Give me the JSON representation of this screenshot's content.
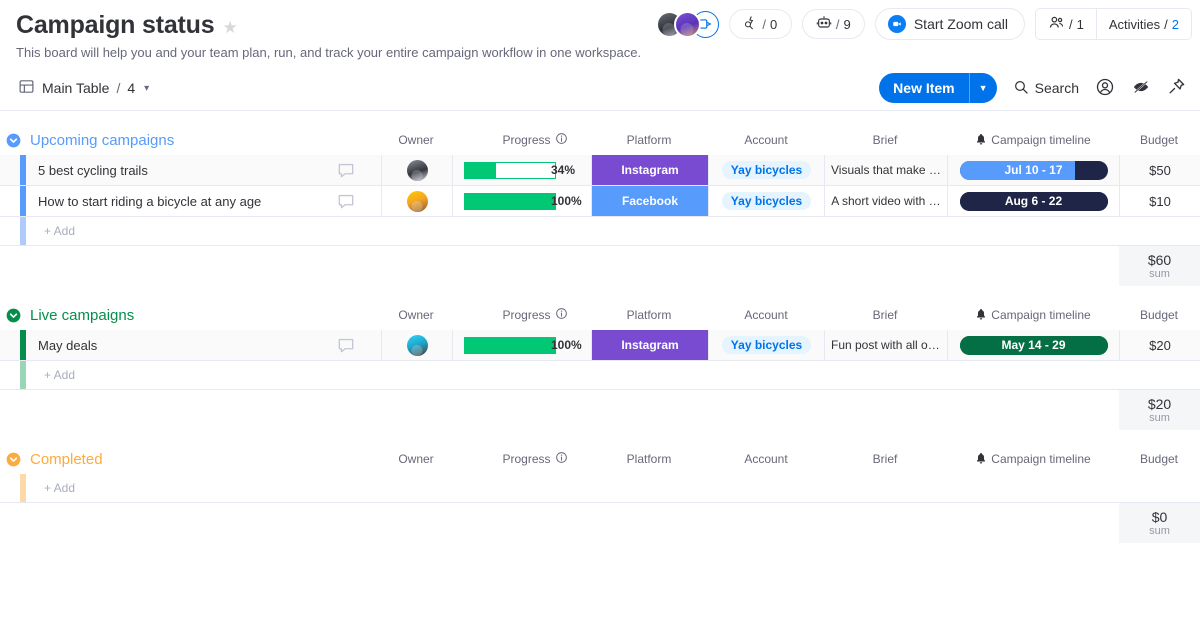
{
  "header": {
    "title": "Campaign status",
    "star_icon": "star-icon",
    "subtitle": "This board will help you and your team plan, run, and track your entire campaign workflow in one workspace.",
    "integrations": {
      "icon": "integrations-icon",
      "slash": "/",
      "count": "0"
    },
    "automations": {
      "icon": "automation-robot-icon",
      "slash": "/",
      "count": "9"
    },
    "zoom_call": {
      "icon": "zoom-camera-icon",
      "label": "Start Zoom call"
    },
    "members": {
      "icon": "people-icon",
      "slash": "/",
      "count": "1"
    },
    "activities": {
      "label": "Activities",
      "slash": "/",
      "count": "2"
    }
  },
  "toolbar": {
    "table_icon": "table-icon",
    "view_name": "Main Table",
    "view_sep": "/",
    "view_count": "4",
    "chevron_icon": "chevron-down-icon",
    "new_item_label": "New Item",
    "new_item_arrow_icon": "chevron-down-icon",
    "search_label": "Search",
    "search_icon": "search-icon",
    "person_icon": "person-circle-icon",
    "hide_icon": "eye-slash-icon",
    "pin_icon": "pin-icon"
  },
  "columns": [
    {
      "key": "owner",
      "label": "Owner",
      "icon": null
    },
    {
      "key": "progress",
      "label": "Progress",
      "icon": "info-icon"
    },
    {
      "key": "platform",
      "label": "Platform",
      "icon": null
    },
    {
      "key": "account",
      "label": "Account",
      "icon": null
    },
    {
      "key": "brief",
      "label": "Brief",
      "icon": null
    },
    {
      "key": "timeline",
      "label": "Campaign timeline",
      "icon": "bell-icon"
    },
    {
      "key": "budget",
      "label": "Budget",
      "icon": null
    }
  ],
  "add_label": "+ Add",
  "sum_label": "sum",
  "colors": {
    "group_upcoming": "#579bfc",
    "group_live": "#038f4b",
    "group_completed": "#fdab3d",
    "instagram": "#784bd1",
    "facebook": "#579bfc",
    "progress_green": "#00c875",
    "timeline_blue": "#579bfc",
    "timeline_dark": "#1f2547",
    "timeline_green": "#046f45",
    "accent_blue": "#0073ea"
  },
  "groups": [
    {
      "name": "Upcoming campaigns",
      "color": "#579bfc",
      "bar_color": "#579bfc",
      "add_bar_color": "#aecbfb",
      "collapse_icon": "collapse-chevron-icon",
      "items": [
        {
          "name": "5 best cycling trails",
          "chat_icon": "chat-bubble-icon",
          "owner_avatar": "avatar",
          "progress_pct": 34,
          "progress_label": "34%",
          "platform": "Instagram",
          "platform_color": "#784bd1",
          "account": "Yay bicycles",
          "brief": "Visuals that make y…",
          "timeline": "Jul 10 - 17",
          "timeline_bg": "#1f2547",
          "timeline_fill": "#579bfc",
          "timeline_fill_pct": 78,
          "budget": "$50",
          "shaded": true
        },
        {
          "name": "How to start riding a bicycle at any age",
          "chat_icon": "chat-bubble-icon",
          "owner_avatar": "avatar",
          "progress_pct": 100,
          "progress_label": "100%",
          "platform": "Facebook",
          "platform_color": "#579bfc",
          "account": "Yay bicycles",
          "brief": "A short video with …",
          "timeline": "Aug 6 - 22",
          "timeline_bg": "#1f2547",
          "timeline_fill": "#1f2547",
          "timeline_fill_pct": 100,
          "budget": "$10",
          "shaded": false
        }
      ],
      "sum": "$60"
    },
    {
      "name": "Live campaigns",
      "color": "#038f4b",
      "bar_color": "#038f4b",
      "add_bar_color": "#9bd5b7",
      "collapse_icon": "collapse-chevron-icon",
      "items": [
        {
          "name": "May deals",
          "chat_icon": "chat-bubble-icon",
          "owner_avatar": "avatar",
          "progress_pct": 100,
          "progress_label": "100%",
          "platform": "Instagram",
          "platform_color": "#784bd1",
          "account": "Yay bicycles",
          "brief": "Fun post with all ou…",
          "timeline": "May 14 - 29",
          "timeline_bg": "#046f45",
          "timeline_fill": "#046f45",
          "timeline_fill_pct": 100,
          "budget": "$20",
          "shaded": true
        }
      ],
      "sum": "$20"
    },
    {
      "name": "Completed",
      "color": "#fdab3d",
      "bar_color": "#fdab3d",
      "add_bar_color": "#fdd9a8",
      "collapse_icon": "collapse-chevron-icon",
      "items": [],
      "sum": "$0"
    }
  ]
}
